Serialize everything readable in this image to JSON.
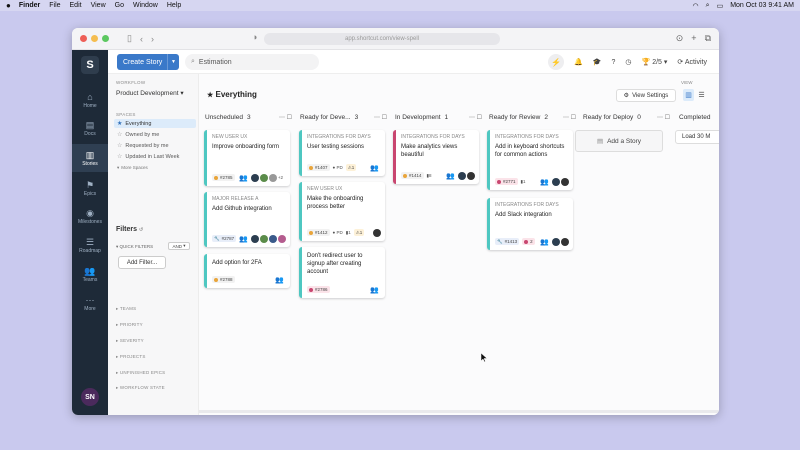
{
  "menubar": {
    "apple": "",
    "items": [
      "Finder",
      "File",
      "Edit",
      "View",
      "Go",
      "Window",
      "Help"
    ],
    "datetime": "Mon Oct 03  9:41 AM"
  },
  "browser": {
    "url": "app.shortcut.com/view-spell"
  },
  "nav": {
    "logo": "S",
    "items": [
      {
        "label": "Home",
        "icon": "⌂"
      },
      {
        "label": "Docs",
        "icon": "▤"
      },
      {
        "label": "Stories",
        "icon": "▥"
      },
      {
        "label": "Epics",
        "icon": "⚑"
      },
      {
        "label": "Milestones",
        "icon": "◉"
      },
      {
        "label": "Roadmap",
        "icon": "☰"
      },
      {
        "label": "Teams",
        "icon": "👥"
      },
      {
        "label": "More",
        "icon": "⋯"
      }
    ],
    "avatar": "SN"
  },
  "topbar": {
    "create_label": "Create Story",
    "search_value": "Estimation",
    "progress": "2/5",
    "activity_label": "Activity"
  },
  "sidebar": {
    "workflow_label": "WORKFLOW",
    "workflow_value": "Product Development",
    "spaces_label": "SPACES",
    "spaces": [
      {
        "label": "Everything"
      },
      {
        "label": "Owned by me"
      },
      {
        "label": "Requested by me"
      },
      {
        "label": "Updated in Last Week"
      }
    ],
    "more_spaces": "More Spaces",
    "filters_title": "Filters",
    "quick_filters": "QUICK FILTERS",
    "and_label": "AND",
    "add_filter": "Add Filter...",
    "sections": [
      "TEAMS",
      "PRIORITY",
      "SEVERITY",
      "PROJECTS",
      "UNFINISHED EPICS",
      "WORKFLOW STATE"
    ]
  },
  "main": {
    "title": "Everything",
    "view_label": "VIEW",
    "view_settings": "View Settings",
    "columns": [
      {
        "name": "Unscheduled",
        "count": "3"
      },
      {
        "name": "Ready for Deve...",
        "count": "3"
      },
      {
        "name": "In Development",
        "count": "1"
      },
      {
        "name": "Ready for Review",
        "count": "2"
      },
      {
        "name": "Ready for Deploy",
        "count": "0"
      },
      {
        "name": "Completed",
        "count": ""
      }
    ],
    "add_story": "Add a Story",
    "load_more": "Load 30 M",
    "cards": {
      "c1": {
        "epic": "NEW USER UX",
        "title": "Improve onboarding form",
        "id": "#2785",
        "more": "+2"
      },
      "c2": {
        "epic": "MAJOR RELEASE A",
        "title": "Add Github integration",
        "id": "#2787"
      },
      "c3": {
        "epic": "",
        "title": "Add option for 2FA",
        "id": "#2788"
      },
      "c4": {
        "epic": "INTEGRATIONS FOR DAYS",
        "title": "User testing sessions",
        "id": "#1407",
        "pd": "PD",
        "est": "1"
      },
      "c5": {
        "epic": "NEW USER UX",
        "title": "Make the onboarding process better",
        "id": "#1412",
        "pd": "PD",
        "m1": "1",
        "est": "1"
      },
      "c6": {
        "epic": "",
        "title": "Don't redirect user to signup after creating account",
        "id": "#2786"
      },
      "c7": {
        "epic": "INTEGRATIONS FOR DAYS",
        "title": "Make analytics views beautiful",
        "id": "#1414",
        "m1": "8"
      },
      "c8": {
        "epic": "INTEGRATIONS FOR DAYS",
        "title": "Add in keyboard shortcuts for common actions",
        "id": "#2771",
        "m1": "1"
      },
      "c9": {
        "epic": "INTEGRATIONS FOR DAYS",
        "title": "Add Slack integration",
        "id": "#1413",
        "m1": "2"
      }
    }
  },
  "colors": {
    "accent": "#3a79c9",
    "nav_bg": "#1e2a38",
    "feature": "#4ec7c1",
    "bug": "#c94670"
  }
}
